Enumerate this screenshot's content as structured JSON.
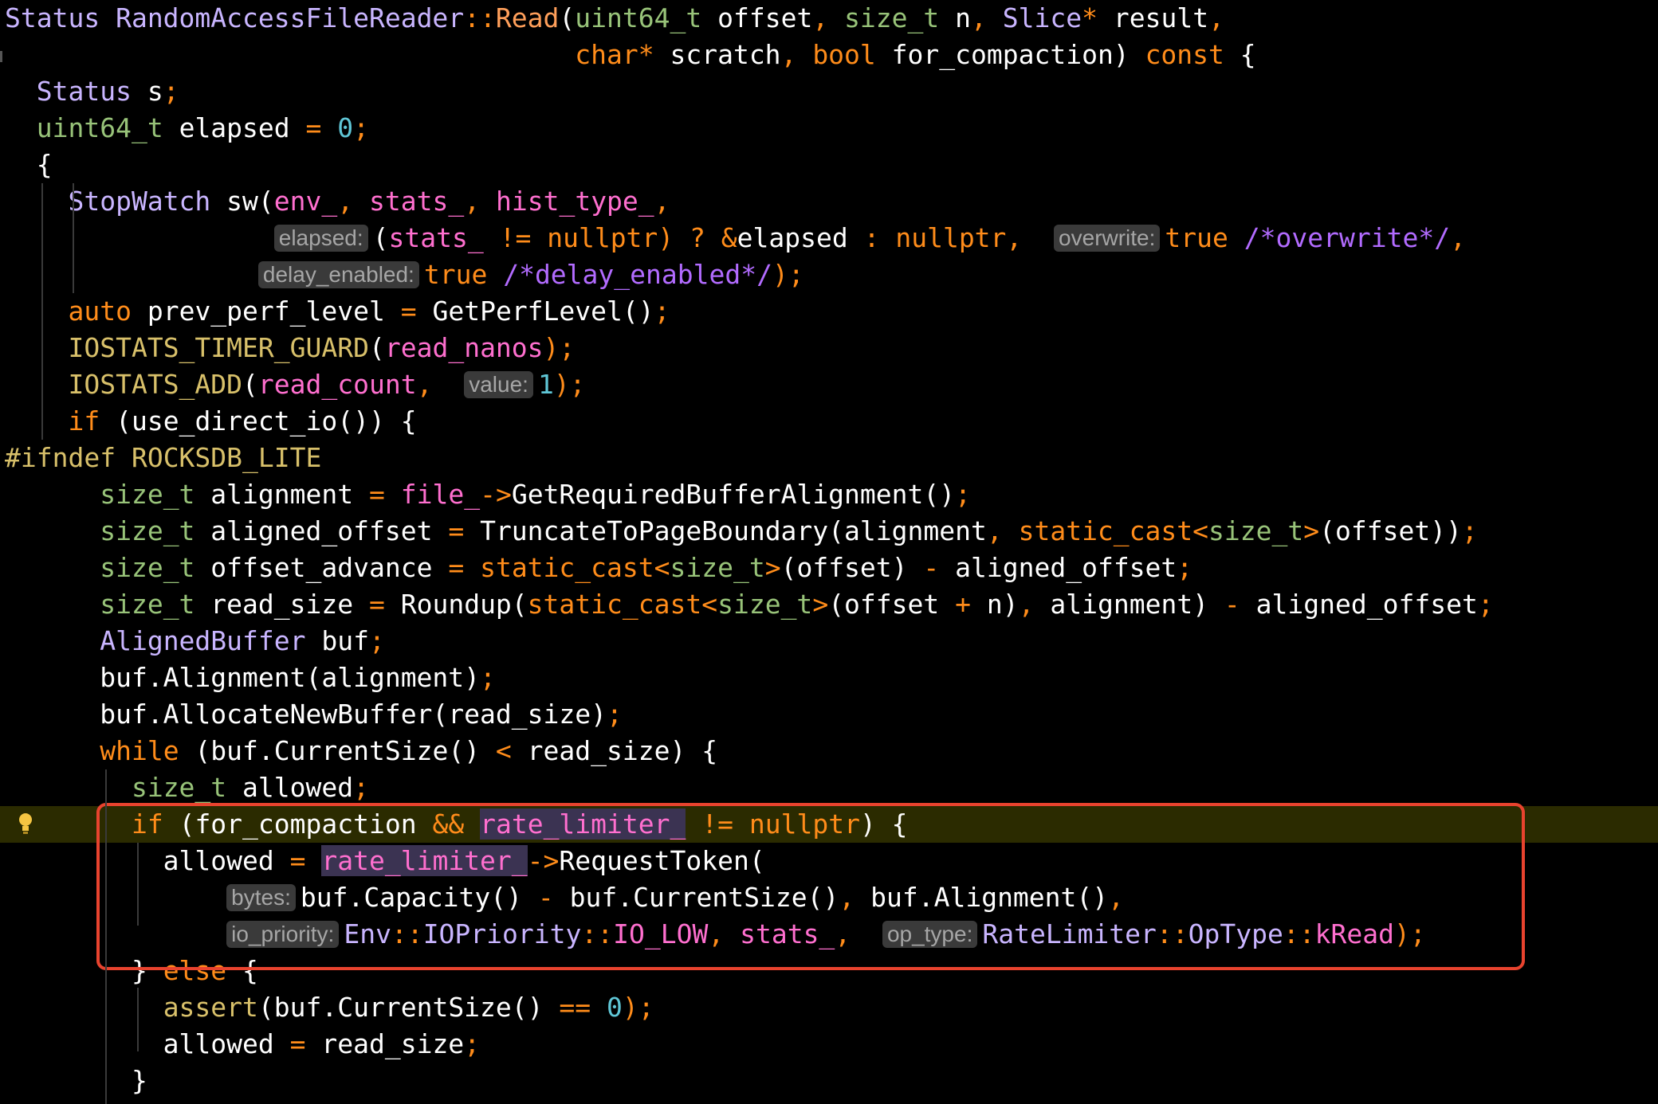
{
  "colors": {
    "background": "#000000",
    "text": "#ffffff",
    "keyword": "#ff8c1a",
    "type": "#98c379",
    "function_name": "#ff9f5a",
    "class_name": "#c9b5ff",
    "field": "#ff6fcf",
    "macro": "#d8c06a",
    "comment": "#b26bff",
    "number": "#5fc6d6",
    "inlay_hint_bg": "#3a3a3a",
    "inlay_hint_text": "#a6a6a6",
    "current_line_bg": "#2b2b00",
    "identifier_highlight_bg": "#3b3352",
    "annotation_box": "#e8432e",
    "lightbulb": "#f5c542"
  },
  "gutter": {
    "lightbulb_icon": "lightbulb-icon",
    "current_line": 22
  },
  "code_lines": [
    [
      [
        "Status ",
        "#c9b5ff"
      ],
      [
        "RandomAccessFileReader",
        "#c9b5ff"
      ],
      [
        "::",
        "#ff8c1a"
      ],
      [
        "Read",
        "#ff9f5a"
      ],
      [
        "(",
        "#ffffff"
      ],
      [
        "uint64_t",
        "#98c379"
      ],
      [
        " offset",
        "#ffffff"
      ],
      [
        ", ",
        "#ff8c1a"
      ],
      [
        "size_t",
        "#98c379"
      ],
      [
        " n",
        "#ffffff"
      ],
      [
        ", ",
        "#ff8c1a"
      ],
      [
        "Slice",
        "#c9b5ff"
      ],
      [
        "*",
        "#ff8c1a"
      ],
      [
        " result",
        "#ffffff"
      ],
      [
        ",",
        "#ff8c1a"
      ]
    ],
    [
      [
        "                                    ",
        "#ffffff"
      ],
      [
        "char",
        "#ff8c1a"
      ],
      [
        "*",
        "#ff8c1a"
      ],
      [
        " scratch",
        "#ffffff"
      ],
      [
        ", ",
        "#ff8c1a"
      ],
      [
        "bool",
        "#ff8c1a"
      ],
      [
        " for_compaction) ",
        "#ffffff"
      ],
      [
        "const",
        "#ff8c1a"
      ],
      [
        " {",
        "#ffffff"
      ]
    ],
    [
      [
        "  ",
        "#ffffff"
      ],
      [
        "Status",
        "#c9b5ff"
      ],
      [
        " s",
        "#ffffff"
      ],
      [
        ";",
        "#ff8c1a"
      ]
    ],
    [
      [
        "  ",
        "#ffffff"
      ],
      [
        "uint64_t",
        "#98c379"
      ],
      [
        " elapsed ",
        "#ffffff"
      ],
      [
        "=",
        "#ff8c1a"
      ],
      [
        " ",
        "#ffffff"
      ],
      [
        "0",
        "#5fc6d6"
      ],
      [
        ";",
        "#ff8c1a"
      ]
    ],
    [
      [
        "  {",
        "#ffffff"
      ]
    ],
    [
      [
        "    ",
        "#ffffff"
      ],
      [
        "StopWatch",
        "#c9b5ff"
      ],
      [
        " sw(",
        "#ffffff"
      ],
      [
        "env_",
        "#ff6fcf"
      ],
      [
        ", ",
        "#ff8c1a"
      ],
      [
        "stats_",
        "#ff6fcf"
      ],
      [
        ", ",
        "#ff8c1a"
      ],
      [
        "hist_type_",
        "#ff6fcf"
      ],
      [
        ",",
        "#ff8c1a"
      ]
    ],
    [
      [
        "                 ",
        "#ffffff"
      ],
      [
        "hint",
        "elapsed:"
      ],
      [
        "(",
        "#ffffff"
      ],
      [
        "stats_",
        "#ff6fcf"
      ],
      [
        " != ",
        "#ff8c1a"
      ],
      [
        "nullptr",
        "#ff8c1a"
      ],
      [
        ") ? ",
        "#ff8c1a"
      ],
      [
        "&",
        "#ff8c1a"
      ],
      [
        "elapsed",
        "#ffffff"
      ],
      [
        " : ",
        "#ff8c1a"
      ],
      [
        "nullptr",
        "#ff8c1a"
      ],
      [
        ", ",
        "#ff8c1a"
      ],
      [
        " ",
        "#ffffff"
      ],
      [
        "hint",
        "overwrite:"
      ],
      [
        "true",
        "#ff8c1a"
      ],
      [
        " ",
        "#ffffff"
      ],
      [
        "/*overwrite*/",
        "#b26bff"
      ],
      [
        ",",
        "#ff8c1a"
      ]
    ],
    [
      [
        "                ",
        "#ffffff"
      ],
      [
        "hint",
        "delay_enabled:"
      ],
      [
        "true",
        "#ff8c1a"
      ],
      [
        " ",
        "#ffffff"
      ],
      [
        "/*delay_enabled*/",
        "#b26bff"
      ],
      [
        ");",
        "#ff8c1a"
      ]
    ],
    [
      [
        "    ",
        "#ffffff"
      ],
      [
        "auto",
        "#ff8c1a"
      ],
      [
        " prev_perf_level ",
        "#ffffff"
      ],
      [
        "=",
        "#ff8c1a"
      ],
      [
        " GetPerfLevel()",
        "#ffffff"
      ],
      [
        ";",
        "#ff8c1a"
      ]
    ],
    [
      [
        "    ",
        "#ffffff"
      ],
      [
        "IOSTATS_TIMER_GUARD",
        "#d8c06a"
      ],
      [
        "(",
        "#ffffff"
      ],
      [
        "read_nanos",
        "#ff6fcf"
      ],
      [
        ");",
        "#ff8c1a"
      ]
    ],
    [
      [
        "    ",
        "#ffffff"
      ],
      [
        "IOSTATS_ADD",
        "#d8c06a"
      ],
      [
        "(",
        "#ffffff"
      ],
      [
        "read_count",
        "#ff6fcf"
      ],
      [
        ", ",
        "#ff8c1a"
      ],
      [
        " ",
        "#ffffff"
      ],
      [
        "hint",
        "value:"
      ],
      [
        "1",
        "#5fc6d6"
      ],
      [
        ");",
        "#ff8c1a"
      ]
    ],
    [
      [
        "    ",
        "#ffffff"
      ],
      [
        "if",
        "#ff8c1a"
      ],
      [
        " (use_direct_io()) {",
        "#ffffff"
      ]
    ],
    [
      [
        "#ifndef ",
        "#d8c06a"
      ],
      [
        "ROCKSDB_LITE",
        "#d8c06a"
      ]
    ],
    [
      [
        "      ",
        "#ffffff"
      ],
      [
        "size_t",
        "#98c379"
      ],
      [
        " alignment ",
        "#ffffff"
      ],
      [
        "=",
        "#ff8c1a"
      ],
      [
        " ",
        "#ffffff"
      ],
      [
        "file_",
        "#ff6fcf"
      ],
      [
        "->",
        "#ff8c1a"
      ],
      [
        "GetRequiredBufferAlignment()",
        "#ffffff"
      ],
      [
        ";",
        "#ff8c1a"
      ]
    ],
    [
      [
        "      ",
        "#ffffff"
      ],
      [
        "size_t",
        "#98c379"
      ],
      [
        " aligned_offset ",
        "#ffffff"
      ],
      [
        "=",
        "#ff8c1a"
      ],
      [
        " TruncateToPageBoundary(alignment",
        "#ffffff"
      ],
      [
        ", ",
        "#ff8c1a"
      ],
      [
        "static_cast",
        "#ff8c1a"
      ],
      [
        "<",
        "#ff8c1a"
      ],
      [
        "size_t",
        "#98c379"
      ],
      [
        ">",
        "#ff8c1a"
      ],
      [
        "(offset))",
        "#ffffff"
      ],
      [
        ";",
        "#ff8c1a"
      ]
    ],
    [
      [
        "      ",
        "#ffffff"
      ],
      [
        "size_t",
        "#98c379"
      ],
      [
        " offset_advance ",
        "#ffffff"
      ],
      [
        "=",
        "#ff8c1a"
      ],
      [
        " ",
        "#ffffff"
      ],
      [
        "static_cast",
        "#ff8c1a"
      ],
      [
        "<",
        "#ff8c1a"
      ],
      [
        "size_t",
        "#98c379"
      ],
      [
        ">",
        "#ff8c1a"
      ],
      [
        "(offset) ",
        "#ffffff"
      ],
      [
        "-",
        "#ff8c1a"
      ],
      [
        " aligned_offset",
        "#ffffff"
      ],
      [
        ";",
        "#ff8c1a"
      ]
    ],
    [
      [
        "      ",
        "#ffffff"
      ],
      [
        "size_t",
        "#98c379"
      ],
      [
        " read_size ",
        "#ffffff"
      ],
      [
        "=",
        "#ff8c1a"
      ],
      [
        " Roundup(",
        "#ffffff"
      ],
      [
        "static_cast",
        "#ff8c1a"
      ],
      [
        "<",
        "#ff8c1a"
      ],
      [
        "size_t",
        "#98c379"
      ],
      [
        ">",
        "#ff8c1a"
      ],
      [
        "(offset ",
        "#ffffff"
      ],
      [
        "+",
        "#ff8c1a"
      ],
      [
        " n)",
        "#ffffff"
      ],
      [
        ", ",
        "#ff8c1a"
      ],
      [
        "alignment) ",
        "#ffffff"
      ],
      [
        "-",
        "#ff8c1a"
      ],
      [
        " aligned_offset",
        "#ffffff"
      ],
      [
        ";",
        "#ff8c1a"
      ]
    ],
    [
      [
        "      ",
        "#ffffff"
      ],
      [
        "AlignedBuffer",
        "#c9b5ff"
      ],
      [
        " buf",
        "#ffffff"
      ],
      [
        ";",
        "#ff8c1a"
      ]
    ],
    [
      [
        "      buf.Alignment(alignment)",
        "#ffffff"
      ],
      [
        ";",
        "#ff8c1a"
      ]
    ],
    [
      [
        "      buf.AllocateNewBuffer(read_size)",
        "#ffffff"
      ],
      [
        ";",
        "#ff8c1a"
      ]
    ],
    [
      [
        "      ",
        "#ffffff"
      ],
      [
        "while",
        "#ff8c1a"
      ],
      [
        " (buf.CurrentSize() ",
        "#ffffff"
      ],
      [
        "<",
        "#ff8c1a"
      ],
      [
        " read_size) {",
        "#ffffff"
      ]
    ],
    [
      [
        "        ",
        "#ffffff"
      ],
      [
        "size_t",
        "#98c379"
      ],
      [
        " allowed",
        "#ffffff"
      ],
      [
        ";",
        "#ff8c1a"
      ]
    ],
    [
      [
        "        ",
        "#ffffff"
      ],
      [
        "if",
        "#ff8c1a"
      ],
      [
        " (for_compaction ",
        "#ffffff"
      ],
      [
        "&&",
        "#ff8c1a"
      ],
      [
        " ",
        "#ffffff"
      ],
      [
        "hl:rate_limiter_",
        "#ff6fcf"
      ],
      [
        " != ",
        "#ff8c1a"
      ],
      [
        "nullptr",
        "#ff8c1a"
      ],
      [
        ") {",
        "#ffffff"
      ]
    ],
    [
      [
        "          allowed ",
        "#ffffff"
      ],
      [
        "=",
        "#ff8c1a"
      ],
      [
        " ",
        "#ffffff"
      ],
      [
        "hl:rate_limiter_",
        "#ff6fcf"
      ],
      [
        "->",
        "#ff8c1a"
      ],
      [
        "RequestToken(",
        "#ffffff"
      ]
    ],
    [
      [
        "              ",
        "#ffffff"
      ],
      [
        "hint",
        "bytes:"
      ],
      [
        "buf.Capacity() ",
        "#ffffff"
      ],
      [
        "-",
        "#ff8c1a"
      ],
      [
        " buf.CurrentSize()",
        "#ffffff"
      ],
      [
        ", ",
        "#ff8c1a"
      ],
      [
        "buf.Alignment()",
        "#ffffff"
      ],
      [
        ",",
        "#ff8c1a"
      ]
    ],
    [
      [
        "              ",
        "#ffffff"
      ],
      [
        "hint",
        "io_priority:"
      ],
      [
        "Env",
        "#c9b5ff"
      ],
      [
        "::",
        "#ff8c1a"
      ],
      [
        "IOPriority",
        "#c9b5ff"
      ],
      [
        "::",
        "#ff8c1a"
      ],
      [
        "IO_LOW",
        "#ff6fcf"
      ],
      [
        ", ",
        "#ff8c1a"
      ],
      [
        "stats_",
        "#ff6fcf"
      ],
      [
        ", ",
        "#ff8c1a"
      ],
      [
        " ",
        "#ffffff"
      ],
      [
        "hint",
        "op_type:"
      ],
      [
        "RateLimiter",
        "#c9b5ff"
      ],
      [
        "::",
        "#ff8c1a"
      ],
      [
        "OpType",
        "#c9b5ff"
      ],
      [
        "::",
        "#ff8c1a"
      ],
      [
        "kRead",
        "#ff6fcf"
      ],
      [
        ");",
        "#ff8c1a"
      ]
    ],
    [
      [
        "        } ",
        "#ffffff"
      ],
      [
        "else",
        "#ff8c1a"
      ],
      [
        " {",
        "#ffffff"
      ]
    ],
    [
      [
        "          ",
        "#ffffff"
      ],
      [
        "assert",
        "#d8c06a"
      ],
      [
        "(buf.CurrentSize() ",
        "#ffffff"
      ],
      [
        "==",
        "#ff8c1a"
      ],
      [
        " ",
        "#ffffff"
      ],
      [
        "0",
        "#5fc6d6"
      ],
      [
        ");",
        "#ff8c1a"
      ]
    ],
    [
      [
        "          allowed ",
        "#ffffff"
      ],
      [
        "=",
        "#ff8c1a"
      ],
      [
        " read_size",
        "#ffffff"
      ],
      [
        ";",
        "#ff8c1a"
      ]
    ],
    [
      [
        "        }",
        "#ffffff"
      ]
    ]
  ]
}
